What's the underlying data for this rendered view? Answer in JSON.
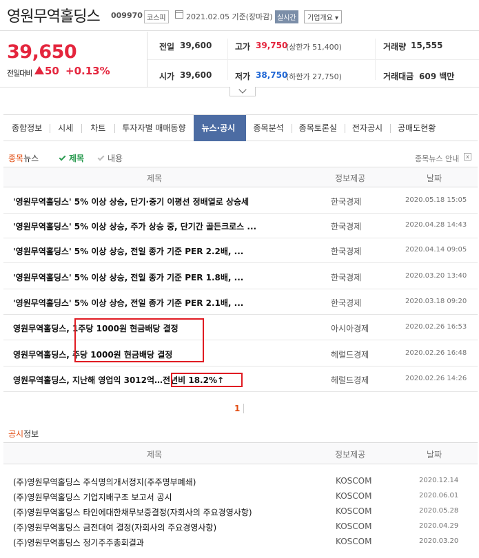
{
  "header": {
    "company": "영원무역홀딩스",
    "code": "009970",
    "market": "코스피",
    "date": "2021.02.05 기준(장마감)",
    "realtime": "실시간",
    "overview": "기업개요 ▾"
  },
  "price": {
    "current": "39,650",
    "change_label": "전일대비",
    "change": "50",
    "change_pct": "+0.13%"
  },
  "summary": {
    "prev_label": "전일",
    "prev": "39,600",
    "high_label": "고가",
    "high": "39,750",
    "upper": "(상한가 51,400)",
    "volume_label": "거래량",
    "volume": "15,555",
    "open_label": "시가",
    "open": "39,600",
    "low_label": "저가",
    "low": "38,750",
    "lower": "(하한가 27,750)",
    "amount_label": "거래대금",
    "amount": "609 백만"
  },
  "tabs": [
    "종합정보",
    "시세",
    "차트",
    "투자자별 매매동향",
    "뉴스·공시",
    "종목분석",
    "종목토론실",
    "전자공시",
    "공매도현황"
  ],
  "active_tab": 4,
  "news": {
    "title_hl": "종목",
    "title_rest": "뉴스",
    "filter_title": "제목",
    "filter_content": "내용",
    "guide": "종목뉴스 안내",
    "guide_close": "x",
    "col_title": "제목",
    "col_source": "정보제공",
    "col_date": "날짜",
    "rows": [
      {
        "title": "'영원무역홀딩스' 5% 이상 상승, 단기·중기 이평선 정배열로 상승세",
        "source": "한국경제",
        "date": "2020.05.18 15:05"
      },
      {
        "title": "'영원무역홀딩스' 5% 이상 상승, 주가 상승 중, 단기간 골든크로스 ...",
        "source": "한국경제",
        "date": "2020.04.28 14:43"
      },
      {
        "title": "'영원무역홀딩스' 5% 이상 상승, 전일 종가 기준 PER 2.2배, ...",
        "source": "한국경제",
        "date": "2020.04.14 09:05"
      },
      {
        "title": "'영원무역홀딩스' 5% 이상 상승, 전일 종가 기준 PER 1.8배, ...",
        "source": "한국경제",
        "date": "2020.03.20 13:40"
      },
      {
        "title": "'영원무역홀딩스' 5% 이상 상승, 전일 종가 기준 PER 2.1배, ...",
        "source": "한국경제",
        "date": "2020.03.18 09:20"
      },
      {
        "title": "영원무역홀딩스, 1주당 1000원 현금배당 결정",
        "source": "아시아경제",
        "date": "2020.02.26 16:53"
      },
      {
        "title": "영원무역홀딩스, 주당 1000원 현금배당 결정",
        "source": "헤럴드경제",
        "date": "2020.02.26 16:48"
      },
      {
        "title": "영원무역홀딩스, 지난해 영업익 3012억…전년비 18.2%↑",
        "source": "헤럴드경제",
        "date": "2020.02.26 14:26"
      }
    ],
    "page": "1"
  },
  "disclosure": {
    "title_hl": "공시",
    "title_rest": "정보",
    "col_title": "제목",
    "col_source": "정보제공",
    "col_date": "날짜",
    "rows": [
      {
        "title": "(주)영원무역홀딩스 주식명의개서정지(주주명부폐쇄)",
        "source": "KOSCOM",
        "date": "2020.12.14"
      },
      {
        "title": "(주)영원무역홀딩스 기업지배구조 보고서 공시",
        "source": "KOSCOM",
        "date": "2020.06.01"
      },
      {
        "title": "(주)영원무역홀딩스 타인에대한채무보증결정(자회사의 주요경영사항)",
        "source": "KOSCOM",
        "date": "2020.05.28"
      },
      {
        "title": "(주)영원무역홀딩스 금전대여 결정(자회사의 주요경영사항)",
        "source": "KOSCOM",
        "date": "2020.04.29"
      },
      {
        "title": "(주)영원무역홀딩스 정기주주총회결과",
        "source": "KOSCOM",
        "date": "2020.03.20"
      }
    ]
  }
}
